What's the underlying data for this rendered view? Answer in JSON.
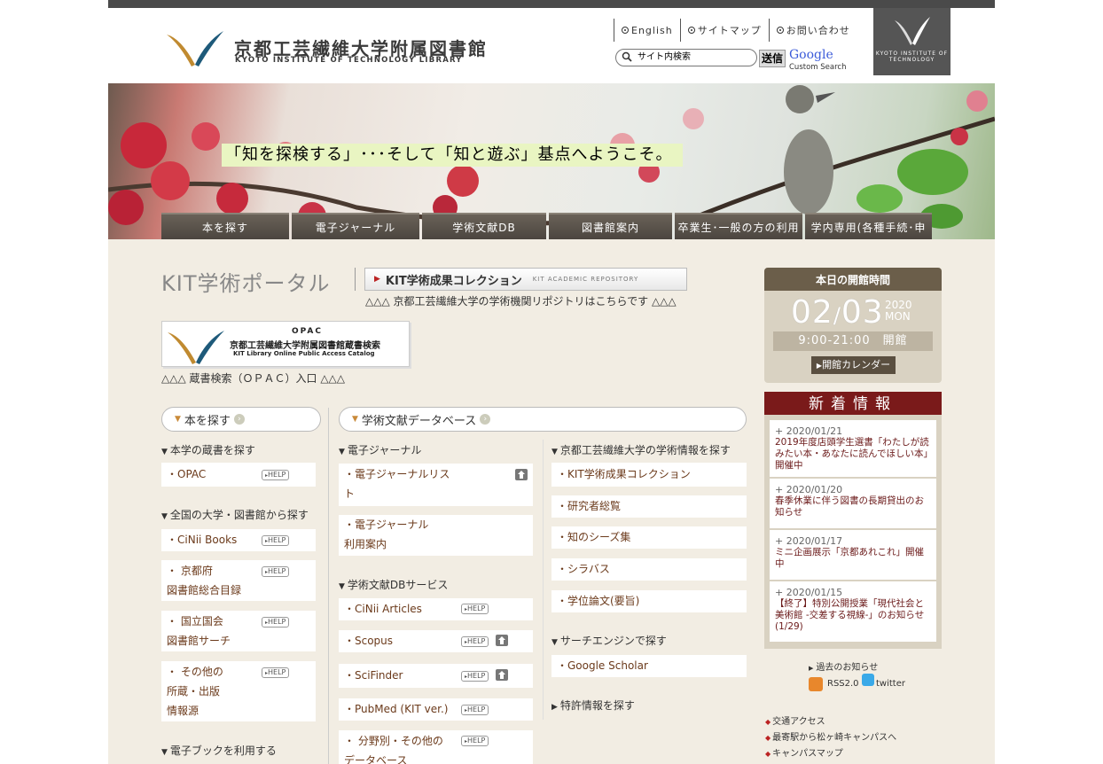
{
  "header": {
    "logo_jp": "京都工芸繊維大学附属図書館",
    "logo_en": "KYOTO INSTITUTE OF TECHNOLOGY LIBRARY",
    "links": [
      "English",
      "サイトマップ",
      "お問い合わせ"
    ],
    "search_placeholder": "サイト内検索",
    "search_button": "送信",
    "google_word": "Google",
    "google_sub": "Custom Search",
    "badge_text": "KYOTO INSTITUTE OF TECHNOLOGY"
  },
  "hero": {
    "tagline": "「知を探検する」･･･そして「知と遊ぶ」基点へようこそ。"
  },
  "nav": [
    "本を探す",
    "電子ジャーナル",
    "学術文献DB",
    "図書館案内",
    "卒業生･一般の方の利用",
    "学内専用(各種手続･申込)"
  ],
  "portal": {
    "title": "KIT学術ポータル",
    "repo_label": "KIT学術成果コレクション",
    "repo_sub": "KIT ACADEMIC REPOSITORY",
    "repo_note": "△△△ 京都工芸繊維大学の学術機関リポジトリはこちらです △△△",
    "opac_t1": "OPAC",
    "opac_t2": "京都工芸繊維大学附属図書館蔵書検索",
    "opac_t3": "KIT Library Online Public Access Catalog",
    "opac_note": "△△△ 蔵書検索（ＯＰＡＣ）入口 △△△"
  },
  "help_label": "HELP",
  "books": {
    "pill": "本を探す",
    "sec1": "本学の蔵書を探す",
    "opac": "・OPAC",
    "sec2": "全国の大学・図書館から探す",
    "cinii_books": "・CiNii Books",
    "kyoto1": "・ 京都府",
    "kyoto2": "図書館総合目録",
    "ndl1": "・ 国立国会",
    "ndl2": "図書館サーチ",
    "other1": "・ その他の",
    "other2": "所蔵・出版",
    "other3": "情報源",
    "sec3": "電子ブックを利用する"
  },
  "db": {
    "pill": "学術文献データベース",
    "ej_sec": "電子ジャーナル",
    "ej1a": "・電子ジャーナルリス",
    "ej1b": "ト",
    "ej2a": "・電子ジャーナル",
    "ej2b": "利用案内",
    "db_sec": "学術文献DBサービス",
    "cinii": "・CiNii Articles",
    "scopus": "・Scopus",
    "scifinder": "・SciFinder",
    "pubmed": "・PubMed (KIT ver.)",
    "field1": "・ 分野別・その他の",
    "field2": "データベース",
    "kit_sec": "京都工芸繊維大学の学術情報を探す",
    "kit1": "・KIT学術成果コレクション",
    "kit2": "・研究者総覧",
    "kit3": "・知のシーズ集",
    "kit4": "・シラバス",
    "kit5": "・学位論文(要旨)",
    "se_sec": "サーチエンジンで探す",
    "scholar": "・Google Scholar",
    "patent": "特許情報を探す"
  },
  "hours": {
    "title": "本日の開館時間",
    "month": "02",
    "slash": "/",
    "day": "03",
    "year": "2020",
    "dow": "MON",
    "time": "9:00-21:00　開館",
    "calendar": "開館カレンダー"
  },
  "news": {
    "title": "新着情報",
    "items": [
      {
        "date": "+ 2020/01/21",
        "text": "2019年度店頭学生選書「わたしが読みたい本・あなたに読んでほしい本」開催中"
      },
      {
        "date": "+ 2020/01/20",
        "text": "春季休業に伴う図書の長期貸出のお知らせ"
      },
      {
        "date": "+ 2020/01/17",
        "text": "ミニ企画展示「京都あれこれ」開催中"
      },
      {
        "date": "+ 2020/01/15",
        "text": "【終了】特別公開授業「現代社会と美術館 -交差する視線-」のお知らせ(1/29)"
      }
    ],
    "past": "過去のお知らせ",
    "rss": "RSS2.0",
    "twitter": "twitter"
  },
  "access": [
    "交通アクセス",
    "最寄駅から松ヶ崎キャンパスへ",
    "キャンパスマップ"
  ],
  "colors": {
    "accent": "#6b5e4a",
    "news_header": "#7a1a1a",
    "bg": "#f2ede3"
  }
}
